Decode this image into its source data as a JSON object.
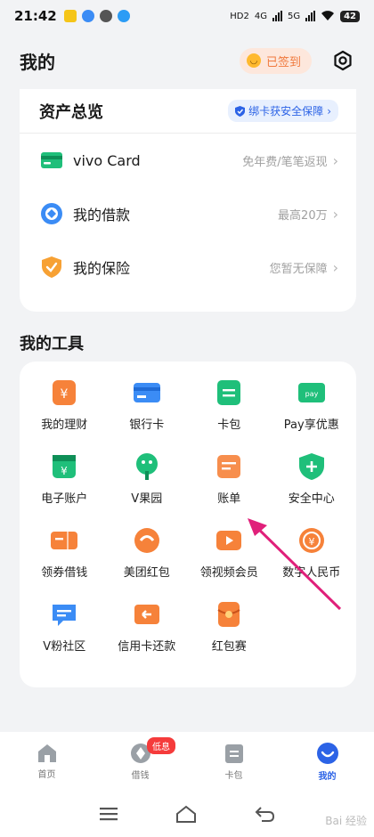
{
  "status_bar": {
    "time": "21:42",
    "network_labels": [
      "HD2",
      "4G",
      "5G"
    ],
    "battery": "42"
  },
  "header": {
    "title": "我的",
    "signin_label": "已签到",
    "settings_icon": "gear-icon"
  },
  "asset_overview": {
    "title": "资产总览",
    "bind_tag": "绑卡获安全保障",
    "rows": [
      {
        "label": "vivo Card",
        "hint": "免年费/笔笔返现",
        "icon": "card-icon",
        "color": "#1fbf7a"
      },
      {
        "label": "我的借款",
        "hint": "最高20万",
        "icon": "loan-icon",
        "color": "#3b8cf5"
      },
      {
        "label": "我的保险",
        "hint": "您暂无保障",
        "icon": "shield-icon",
        "color": "#f7a134"
      }
    ]
  },
  "tools": {
    "title": "我的工具",
    "items": [
      {
        "label": "我的理财",
        "icon": "wealth-icon",
        "color": "#f6823a"
      },
      {
        "label": "银行卡",
        "icon": "bankcard-icon",
        "color": "#3b8cf5"
      },
      {
        "label": "卡包",
        "icon": "cardpack-icon",
        "color": "#1fbf7a"
      },
      {
        "label": "Pay享优惠",
        "icon": "pay-icon",
        "color": "#1fbf7a"
      },
      {
        "label": "电子账户",
        "icon": "eaccount-icon",
        "color": "#1fbf7a"
      },
      {
        "label": "V果园",
        "icon": "tree-icon",
        "color": "#1fbf7a"
      },
      {
        "label": "账单",
        "icon": "bill-icon",
        "color": "#f6823a"
      },
      {
        "label": "安全中心",
        "icon": "security-icon",
        "color": "#1fbf7a"
      },
      {
        "label": "领券借钱",
        "icon": "coupon-icon",
        "color": "#f6823a"
      },
      {
        "label": "美团红包",
        "icon": "meituan-icon",
        "color": "#f6823a"
      },
      {
        "label": "领视频会员",
        "icon": "video-icon",
        "color": "#f6823a"
      },
      {
        "label": "数字人民币",
        "icon": "ecny-icon",
        "color": "#f6823a"
      },
      {
        "label": "V粉社区",
        "icon": "community-icon",
        "color": "#3b8cf5"
      },
      {
        "label": "信用卡还款",
        "icon": "repay-icon",
        "color": "#f6823a"
      },
      {
        "label": "红包赛",
        "icon": "redpacket-icon",
        "color": "#f6823a"
      }
    ]
  },
  "bottom_nav": {
    "items": [
      {
        "label": "首页",
        "icon": "home-icon"
      },
      {
        "label": "借钱",
        "icon": "borrow-icon",
        "badge": "低息"
      },
      {
        "label": "卡包",
        "icon": "wallet-icon"
      },
      {
        "label": "我的",
        "icon": "profile-icon",
        "active": true
      }
    ]
  },
  "system_nav": [
    "menu-icon",
    "home-nav-icon",
    "back-icon"
  ],
  "colors": {
    "accent": "#2c63e6",
    "orange": "#f6823a",
    "green": "#1fbf7a",
    "arrow": "#e0207a"
  },
  "watermark": "Bai 经验"
}
